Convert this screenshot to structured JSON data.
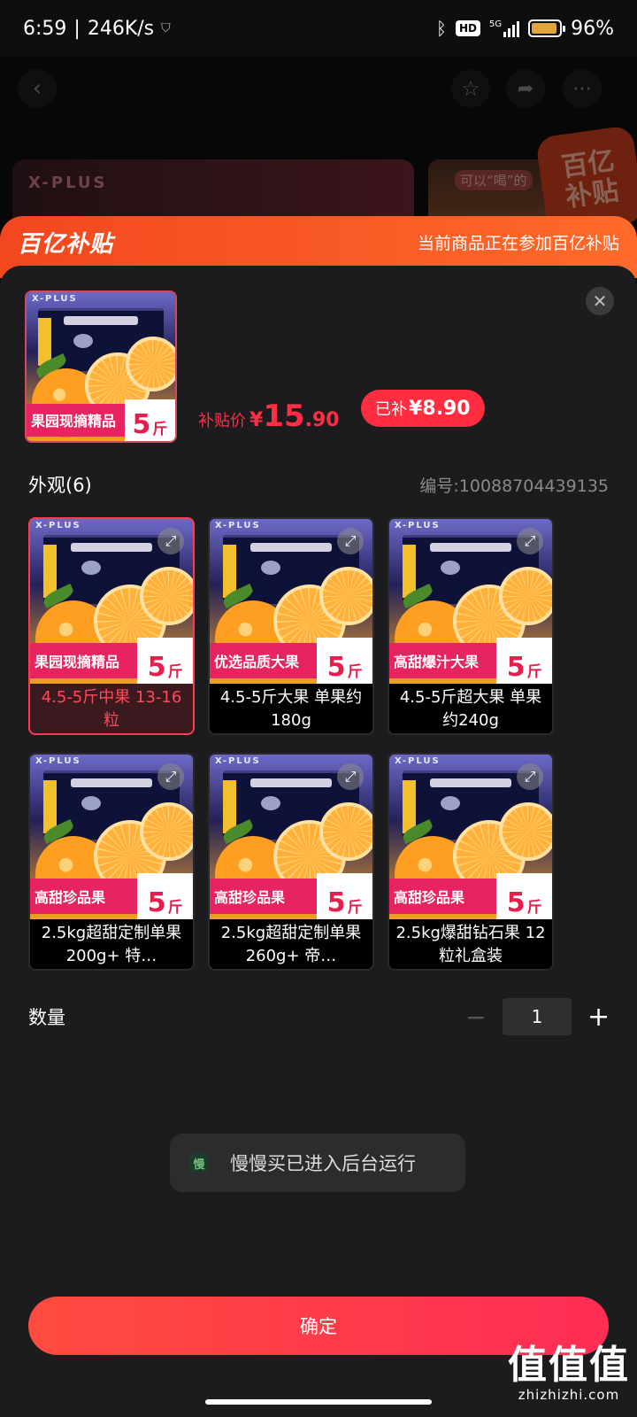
{
  "status_bar": {
    "time": "6:59",
    "speed": "246K/s",
    "network": "5G",
    "hd": "HD",
    "battery": "96%",
    "battery_level": 0.96
  },
  "background": {
    "banner_text": "X-PLUS",
    "banner2_text": "可以“喝”的",
    "badge_line1": "百亿",
    "badge_line2": "补贴"
  },
  "subsidy_header": {
    "logo": "百亿补贴",
    "note": "当前商品正在参加百亿补贴"
  },
  "product": {
    "tag_text": "果园现摘精品",
    "tag_num": "5",
    "tag_unit": "斤",
    "price_label": "补贴价",
    "currency": "¥",
    "price_int": "15",
    "price_dec": ".90",
    "subsidized_label": "已补",
    "subsidized_amount": "¥8.90"
  },
  "appearance": {
    "title": "外观(6)",
    "sku_number": "编号:10088704439135"
  },
  "options": [
    {
      "tag": "果园现摘精品",
      "num": "5",
      "unit": "斤",
      "label": "4.5-5斤中果 13-16粒",
      "selected": true
    },
    {
      "tag": "优选品质大果",
      "num": "5",
      "unit": "斤",
      "label": "4.5-5斤大果 单果约180g",
      "selected": false
    },
    {
      "tag": "高甜爆汁大果",
      "num": "5",
      "unit": "斤",
      "label": "4.5-5斤超大果 单果约240g",
      "selected": false
    },
    {
      "tag": "高甜珍品果",
      "num": "5",
      "unit": "斤",
      "label": "2.5kg超甜定制单果200g+ 特…",
      "selected": false
    },
    {
      "tag": "高甜珍品果",
      "num": "5",
      "unit": "斤",
      "label": "2.5kg超甜定制单果260g+ 帝…",
      "selected": false
    },
    {
      "tag": "高甜珍品果",
      "num": "5",
      "unit": "斤",
      "label": "2.5kg爆甜钻石果 12粒礼盒装",
      "selected": false
    }
  ],
  "xplus_text": "X-PLUS",
  "quantity": {
    "label": "数量",
    "value": "1",
    "minus": "−",
    "plus": "+"
  },
  "toast": {
    "app_icon": "慢",
    "message": "慢慢买已进入后台运行"
  },
  "confirm_label": "确定",
  "watermark": {
    "big": "值值值",
    "small": "zhizhizhi.com"
  },
  "colors": {
    "accent": "#ff2d45",
    "subsidy_orange": "#f2471f",
    "tag_pink": "#e72460"
  }
}
